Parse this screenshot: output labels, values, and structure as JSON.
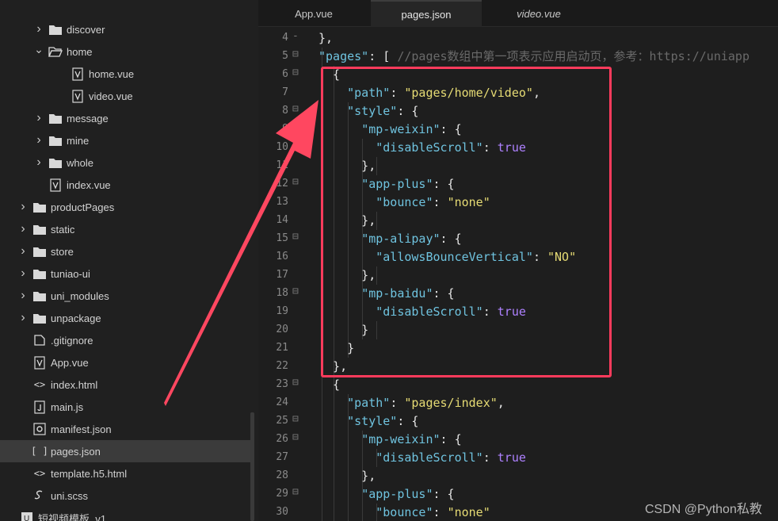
{
  "sidebar": {
    "items": [
      {
        "label": "discover",
        "icon": "folder-icon",
        "twisty": "chevron-right-icon"
      },
      {
        "label": "home",
        "icon": "folder-open-icon",
        "twisty": "chevron-down-icon"
      },
      {
        "label": "home.vue",
        "icon": "vue-file-icon"
      },
      {
        "label": "video.vue",
        "icon": "vue-file-icon"
      },
      {
        "label": "message",
        "icon": "folder-icon",
        "twisty": "chevron-right-icon"
      },
      {
        "label": "mine",
        "icon": "folder-icon",
        "twisty": "chevron-right-icon"
      },
      {
        "label": "whole",
        "icon": "folder-icon",
        "twisty": "chevron-right-icon"
      },
      {
        "label": "index.vue",
        "icon": "vue-file-icon"
      },
      {
        "label": "productPages",
        "icon": "folder-icon",
        "twisty": "chevron-right-icon"
      },
      {
        "label": "static",
        "icon": "folder-icon",
        "twisty": "chevron-right-icon"
      },
      {
        "label": "store",
        "icon": "folder-icon",
        "twisty": "chevron-right-icon"
      },
      {
        "label": "tuniao-ui",
        "icon": "folder-icon",
        "twisty": "chevron-right-icon"
      },
      {
        "label": "uni_modules",
        "icon": "folder-icon",
        "twisty": "chevron-right-icon"
      },
      {
        "label": "unpackage",
        "icon": "folder-icon",
        "twisty": "chevron-right-icon"
      },
      {
        "label": ".gitignore",
        "icon": "file-icon"
      },
      {
        "label": "App.vue",
        "icon": "vue-file-icon"
      },
      {
        "label": "index.html",
        "icon": "html-file-icon"
      },
      {
        "label": "main.js",
        "icon": "js-file-icon"
      },
      {
        "label": "manifest.json",
        "icon": "manifest-gear-icon"
      },
      {
        "label": "pages.json",
        "icon": "json-file-icon",
        "selected": true
      },
      {
        "label": "template.h5.html",
        "icon": "html-file-icon"
      },
      {
        "label": "uni.scss",
        "icon": "scss-file-icon"
      },
      {
        "label": "短视频模板_v1",
        "icon": "project-icon"
      }
    ]
  },
  "tabs": [
    {
      "label": "App.vue"
    },
    {
      "label": "pages.json",
      "active": true
    },
    {
      "label": "video.vue",
      "italic": true
    }
  ],
  "code": {
    "line_numbers": [
      "4",
      "5",
      "6",
      "7",
      "8",
      "9",
      "10",
      "11",
      "12",
      "13",
      "14",
      "15",
      "16",
      "17",
      "18",
      "19",
      "20",
      "21",
      "22",
      "23",
      "24",
      "25",
      "26",
      "27",
      "28",
      "29",
      "30"
    ],
    "fold_markers": [
      "-",
      "⊟",
      "⊟",
      "",
      "⊟",
      "⊟",
      "",
      "",
      "⊟",
      "",
      "",
      "⊟",
      "",
      "",
      "⊟",
      "",
      "",
      "",
      "",
      "⊟",
      "",
      "⊟",
      "⊟",
      "",
      "",
      "⊟",
      ""
    ],
    "lines": [
      [
        {
          "t": "p",
          "v": "},"
        }
      ],
      [
        {
          "t": "k",
          "v": "\"pages\""
        },
        {
          "t": "p",
          "v": ": [ "
        },
        {
          "t": "c",
          "v": "//pages数组中第一项表示应用启动页，参考：https://uniapp"
        }
      ],
      [
        {
          "t": "p",
          "v": "  {"
        }
      ],
      [
        {
          "t": "p",
          "v": "    "
        },
        {
          "t": "k",
          "v": "\"path\""
        },
        {
          "t": "p",
          "v": ": "
        },
        {
          "t": "s",
          "v": "\"pages/home/video\""
        },
        {
          "t": "p",
          "v": ","
        }
      ],
      [
        {
          "t": "p",
          "v": "    "
        },
        {
          "t": "k",
          "v": "\"style\""
        },
        {
          "t": "p",
          "v": ": {"
        }
      ],
      [
        {
          "t": "p",
          "v": "      "
        },
        {
          "t": "k",
          "v": "\"mp-weixin\""
        },
        {
          "t": "p",
          "v": ": {"
        }
      ],
      [
        {
          "t": "p",
          "v": "        "
        },
        {
          "t": "k",
          "v": "\"disableScroll\""
        },
        {
          "t": "p",
          "v": ": "
        },
        {
          "t": "b",
          "v": "true"
        }
      ],
      [
        {
          "t": "p",
          "v": "      },"
        }
      ],
      [
        {
          "t": "p",
          "v": "      "
        },
        {
          "t": "k",
          "v": "\"app-plus\""
        },
        {
          "t": "p",
          "v": ": {"
        }
      ],
      [
        {
          "t": "p",
          "v": "        "
        },
        {
          "t": "k",
          "v": "\"bounce\""
        },
        {
          "t": "p",
          "v": ": "
        },
        {
          "t": "s",
          "v": "\"none\""
        }
      ],
      [
        {
          "t": "p",
          "v": "      },"
        }
      ],
      [
        {
          "t": "p",
          "v": "      "
        },
        {
          "t": "k",
          "v": "\"mp-alipay\""
        },
        {
          "t": "p",
          "v": ": {"
        }
      ],
      [
        {
          "t": "p",
          "v": "        "
        },
        {
          "t": "k",
          "v": "\"allowsBounceVertical\""
        },
        {
          "t": "p",
          "v": ": "
        },
        {
          "t": "s",
          "v": "\"NO\""
        }
      ],
      [
        {
          "t": "p",
          "v": "      },"
        }
      ],
      [
        {
          "t": "p",
          "v": "      "
        },
        {
          "t": "k",
          "v": "\"mp-baidu\""
        },
        {
          "t": "p",
          "v": ": {"
        }
      ],
      [
        {
          "t": "p",
          "v": "        "
        },
        {
          "t": "k",
          "v": "\"disableScroll\""
        },
        {
          "t": "p",
          "v": ": "
        },
        {
          "t": "b",
          "v": "true"
        }
      ],
      [
        {
          "t": "p",
          "v": "      }"
        }
      ],
      [
        {
          "t": "p",
          "v": "    }"
        }
      ],
      [
        {
          "t": "p",
          "v": "  },"
        }
      ],
      [
        {
          "t": "p",
          "v": "  {"
        }
      ],
      [
        {
          "t": "p",
          "v": "    "
        },
        {
          "t": "k",
          "v": "\"path\""
        },
        {
          "t": "p",
          "v": ": "
        },
        {
          "t": "s",
          "v": "\"pages/index\""
        },
        {
          "t": "p",
          "v": ","
        }
      ],
      [
        {
          "t": "p",
          "v": "    "
        },
        {
          "t": "k",
          "v": "\"style\""
        },
        {
          "t": "p",
          "v": ": {"
        }
      ],
      [
        {
          "t": "p",
          "v": "      "
        },
        {
          "t": "k",
          "v": "\"mp-weixin\""
        },
        {
          "t": "p",
          "v": ": {"
        }
      ],
      [
        {
          "t": "p",
          "v": "        "
        },
        {
          "t": "k",
          "v": "\"disableScroll\""
        },
        {
          "t": "p",
          "v": ": "
        },
        {
          "t": "b",
          "v": "true"
        }
      ],
      [
        {
          "t": "p",
          "v": "      },"
        }
      ],
      [
        {
          "t": "p",
          "v": "      "
        },
        {
          "t": "k",
          "v": "\"app-plus\""
        },
        {
          "t": "p",
          "v": ": {"
        }
      ],
      [
        {
          "t": "p",
          "v": "        "
        },
        {
          "t": "k",
          "v": "\"bounce\""
        },
        {
          "t": "p",
          "v": ": "
        },
        {
          "t": "s",
          "v": "\"none\""
        }
      ]
    ]
  },
  "watermark": "CSDN @Python私教",
  "colors": {
    "key": "#6fc3df",
    "string": "#e6db74",
    "boolean": "#ae81ff",
    "comment": "#6a6a6a",
    "highlight": "#ff3b5c"
  }
}
